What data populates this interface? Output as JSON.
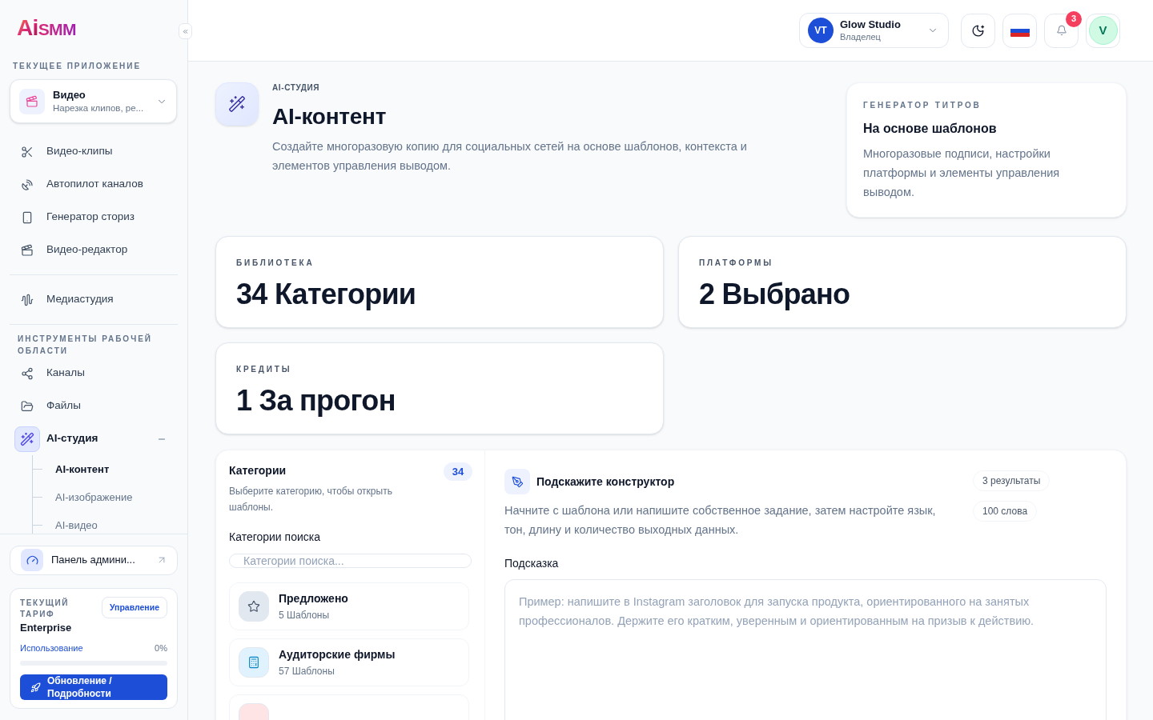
{
  "sidebar": {
    "logo": {
      "mark": "Ai",
      "text": "SMM"
    },
    "current_app_label": "ТЕКУЩЕЕ ПРИЛОЖЕНИЕ",
    "app_selector": {
      "title": "Видео",
      "subtitle": "Нарезка клипов, ре..."
    },
    "app_items": [
      {
        "label": "Видео-клипы",
        "selected": false
      },
      {
        "label": "Автопилот каналов",
        "selected": false
      },
      {
        "label": "Генератор сториз",
        "selected": false
      },
      {
        "label": "Видео-редактор",
        "selected": false
      }
    ],
    "media_items": [
      {
        "label": "Медиастудия",
        "selected": false
      }
    ],
    "workspace_label": "ИНСТРУМЕНТЫ РАБОЧЕЙ ОБЛАСТИ",
    "workspace_items": [
      {
        "kind": "link",
        "label": "Каналы",
        "selected": false
      },
      {
        "kind": "link",
        "label": "Файлы",
        "selected": false
      },
      {
        "kind": "group",
        "label": "AI-студия",
        "selected": true,
        "expanded": true,
        "children": [
          {
            "label": "AI-контент",
            "selected": true
          },
          {
            "label": "AI-изображение",
            "selected": false
          },
          {
            "label": "AI-видео",
            "selected": false
          }
        ]
      }
    ],
    "admin_link": "Панель админи...",
    "plan": {
      "label": "ТЕКУЩИЙ ТАРИФ",
      "manage_button": "Управление",
      "name": "Enterprise",
      "usage_label": "Использование",
      "usage_value": "0%",
      "level": 0,
      "upgrade_button": "Обновление / Подробности"
    }
  },
  "header": {
    "workspace": {
      "avatar": "VT",
      "name": "Glow Studio",
      "role": "Владелец"
    },
    "notifications": "3",
    "user_avatar": "V"
  },
  "hero": {
    "eyebrow": "AI-СТУДИЯ",
    "title": "AI-контент",
    "description": "Создайте многоразовую копию для социальных сетей на основе шаблонов, контекста и элементов управления выводом."
  },
  "info_card": {
    "eyebrow": "ГЕНЕРАТОР ТИТРОВ",
    "title": "На основе шаблонов",
    "description": "Многоразовые подписи, настройки платформы и элементы управления выводом."
  },
  "stats": [
    {
      "label": "БИБЛИОТЕКА",
      "value": "34 Категории"
    },
    {
      "label": "ПЛАТФОРМЫ",
      "value": "2 Выбрано"
    },
    {
      "label": "КРЕДИТЫ",
      "value": "1 За прогон"
    }
  ],
  "categories": {
    "title": "Категории",
    "count": "34",
    "description": "Выберите категорию, чтобы открыть шаблоны.",
    "search_label": "Категории поиска",
    "search_placeholder": "Категории поиска...",
    "items": [
      {
        "name": "Предложено",
        "count": "5 Шаблоны",
        "color": "#e2e8f0"
      },
      {
        "name": "Аудиторские фирмы",
        "count": "57 Шаблоны",
        "color": "#e0f2fe"
      },
      {
        "color": "#ffe4e6"
      }
    ]
  },
  "prompt_builder": {
    "title": "Подскажите конструктор",
    "description": "Начните с шаблона или напишите собственное задание, затем настройте язык, тон, длину и количество выходных данных.",
    "chips": [
      "3 результаты",
      "100 слова"
    ],
    "prompt_label": "Подсказка",
    "prompt_placeholder": "Пример: напишите в Instagram заголовок для запуска продукта, ориентированного на занятых профессионалов. Держите его кратким, уверенным и ориентированным на призыв к действию."
  }
}
